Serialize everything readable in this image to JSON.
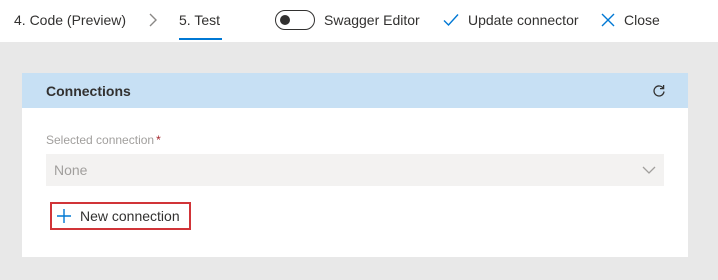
{
  "toolbar": {
    "step_code": "4. Code (Preview)",
    "step_test": "5. Test",
    "swagger_label": "Swagger Editor",
    "swagger_enabled": false,
    "update_label": "Update connector",
    "close_label": "Close"
  },
  "connections": {
    "title": "Connections",
    "field_label": "Selected connection",
    "required_mark": "*",
    "selected_value": "None",
    "new_connection_label": "New connection"
  },
  "colors": {
    "accent": "#0078d4",
    "header_bg": "#c7e0f4",
    "highlight_border": "#d13438",
    "canvas_bg": "#e8e8e8"
  },
  "icons": {
    "breadcrumb": "chevron-right-icon",
    "update": "checkmark-icon",
    "close": "close-icon",
    "refresh": "refresh-icon",
    "dropdown": "chevron-down-icon",
    "add": "plus-icon"
  }
}
